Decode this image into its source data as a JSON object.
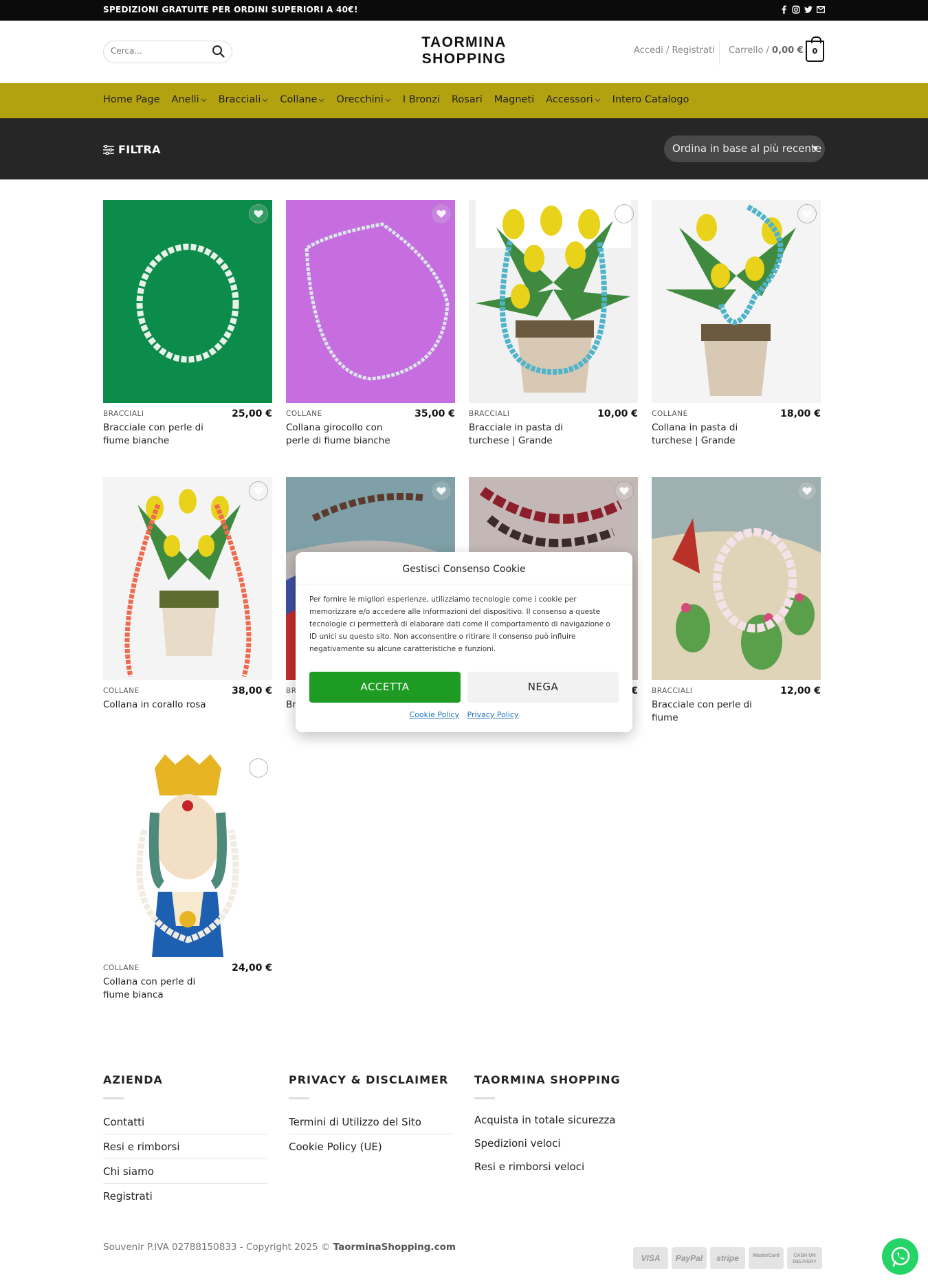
{
  "topbar": {
    "message": "SPEDIZIONI GRATUITE PER ORDINI SUPERIORI A 40€!",
    "social_icons": [
      "facebook-icon",
      "instagram-icon",
      "twitter-icon",
      "envelope-icon"
    ]
  },
  "header": {
    "search_placeholder": "Cerca...",
    "logo_line1": "TAORMINA",
    "logo_line2": "SHOPPING",
    "account_label": "Accedi / Registrati",
    "cart_label": "Carrello /",
    "cart_total": "0,00 €",
    "cart_count": "0"
  },
  "nav": {
    "items": [
      {
        "label": "Home Page",
        "has_dropdown": false
      },
      {
        "label": "Anelli",
        "has_dropdown": true
      },
      {
        "label": "Bracciali",
        "has_dropdown": true
      },
      {
        "label": "Collane",
        "has_dropdown": true
      },
      {
        "label": "Orecchini",
        "has_dropdown": true
      },
      {
        "label": "I Bronzi",
        "has_dropdown": false
      },
      {
        "label": "Rosari",
        "has_dropdown": false
      },
      {
        "label": "Magneti",
        "has_dropdown": false
      },
      {
        "label": "Accessori",
        "has_dropdown": true
      },
      {
        "label": "Intero Catalogo",
        "has_dropdown": false
      }
    ],
    "bg_color": "#b3a20f"
  },
  "filterbar": {
    "filter_label": "FILTRA",
    "sort_selected": "Ordina in base al più recente"
  },
  "products": [
    {
      "category": "BRACCIALI",
      "price": "25,00 €",
      "title": "Bracciale con perle di fiume bianche"
    },
    {
      "category": "COLLANE",
      "price": "35,00 €",
      "title": "Collana girocollo con perle di fiume bianche"
    },
    {
      "category": "BRACCIALI",
      "price": "10,00 €",
      "title": "Bracciale in pasta di turchese | Grande"
    },
    {
      "category": "COLLANE",
      "price": "18,00 €",
      "title": "Collana in pasta di turchese | Grande"
    },
    {
      "category": "COLLANE",
      "price": "38,00 €",
      "title": "Collana in corallo rosa"
    },
    {
      "category": "BR",
      "price": "",
      "title": "Br co"
    },
    {
      "category": "",
      "price": "€",
      "title": ""
    },
    {
      "category": "BRACCIALI",
      "price": "12,00 €",
      "title": "Bracciale con perle di fiume"
    },
    {
      "category": "COLLANE",
      "price": "24,00 €",
      "title": "Collana con perle di fiume bianca"
    }
  ],
  "cookie": {
    "title": "Gestisci Consenso Cookie",
    "text": "Per fornire le migliori esperienze, utilizziamo tecnologie come i cookie per memorizzare e/o accedere alle informazioni del dispositivo. Il consenso a queste tecnologie ci permetterà di elaborare dati come il comportamento di navigazione o ID unici su questo sito. Non acconsentire o ritirare il consenso può influire negativamente su alcune caratteristiche e funzioni.",
    "accept_label": "ACCETTA",
    "deny_label": "NEGA",
    "cookie_policy_link": "Cookie Policy",
    "privacy_policy_link": "Privacy Policy",
    "accept_color": "#1e9b22"
  },
  "footer": {
    "col1": {
      "title": "AZIENDA",
      "items": [
        "Contatti",
        "Resi e rimborsi",
        "Chi siamo",
        "Registrati"
      ]
    },
    "col2": {
      "title": "PRIVACY & DISCLAIMER",
      "items": [
        "Termini di Utilizzo del Sito",
        "Cookie Policy (UE)"
      ]
    },
    "col3": {
      "title": "TAORMINA SHOPPING",
      "items": [
        "Acquista in totale sicurezza",
        "Spedizioni veloci",
        "Resi e rimborsi veloci"
      ]
    },
    "copyright_prefix": "Souvenir P.IVA 02788150833 - Copyright 2025 ©",
    "copyright_site": "TaorminaShopping.com",
    "payments": [
      "VISA",
      "PayPal",
      "stripe",
      "MasterCard",
      "CASH ON DELIVERY"
    ]
  }
}
